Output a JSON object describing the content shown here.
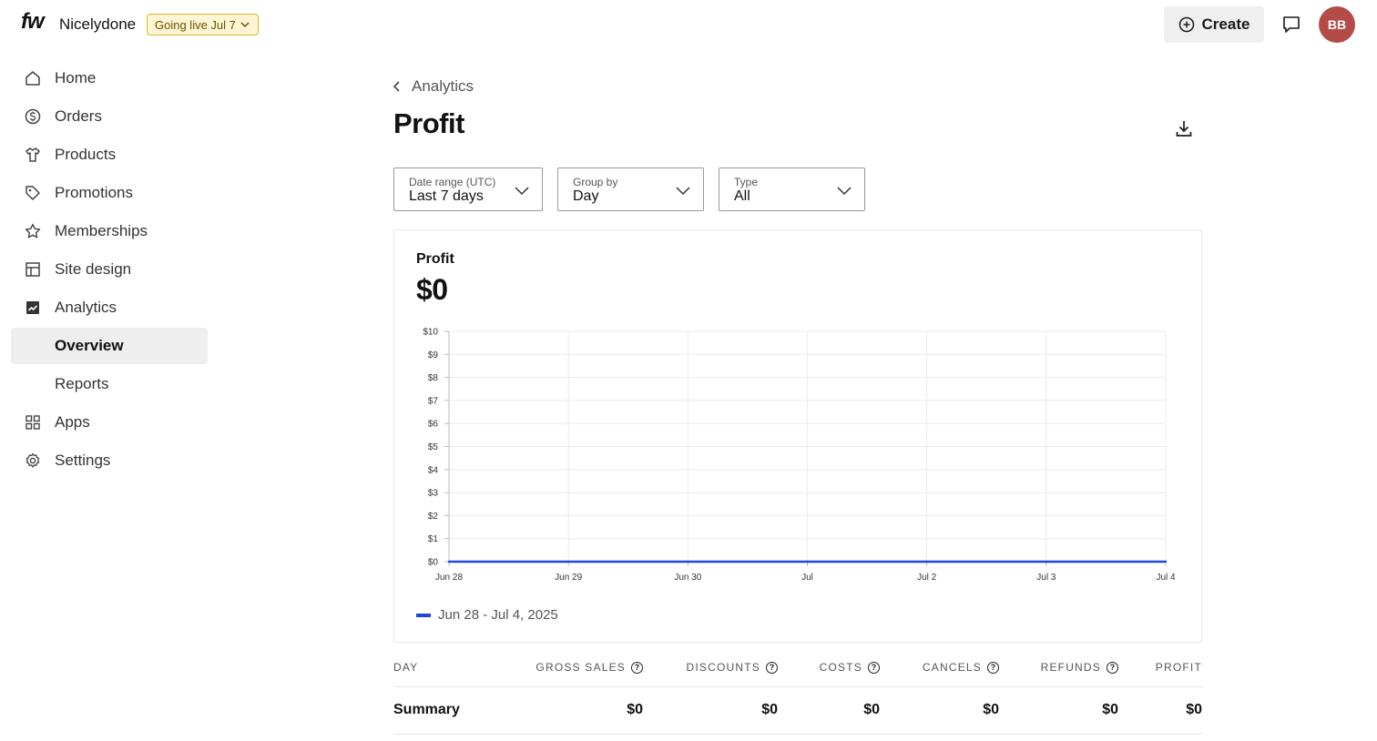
{
  "app": {
    "logo": "fw",
    "store_name": "Nicelydone",
    "go_live_label": "Going live Jul 7",
    "create_label": "Create",
    "avatar_initials": "BB"
  },
  "sidebar": {
    "items": [
      {
        "label": "Home",
        "icon": "home-icon"
      },
      {
        "label": "Orders",
        "icon": "dollar-circle-icon"
      },
      {
        "label": "Products",
        "icon": "shirt-icon"
      },
      {
        "label": "Promotions",
        "icon": "tag-icon"
      },
      {
        "label": "Memberships",
        "icon": "star-icon"
      },
      {
        "label": "Site design",
        "icon": "layout-icon"
      },
      {
        "label": "Analytics",
        "icon": "chart-icon"
      },
      {
        "label": "Overview",
        "active": true
      },
      {
        "label": "Reports"
      },
      {
        "label": "Apps",
        "icon": "grid-icon"
      },
      {
        "label": "Settings",
        "icon": "gear-icon"
      }
    ]
  },
  "main": {
    "breadcrumb": "Analytics",
    "title": "Profit",
    "filters": {
      "date_range": {
        "label": "Date range (UTC)",
        "value": "Last 7 days"
      },
      "group_by": {
        "label": "Group by",
        "value": "Day"
      },
      "type": {
        "label": "Type",
        "value": "All"
      }
    },
    "card": {
      "title": "Profit",
      "value": "$0"
    }
  },
  "chart_data": {
    "type": "line",
    "x": [
      "Jun 28",
      "Jun 29",
      "Jun 30",
      "Jul",
      "Jul 2",
      "Jul 3",
      "Jul 4"
    ],
    "series": [
      {
        "name": "Jun 28 - Jul 4, 2025",
        "values": [
          0,
          0,
          0,
          0,
          0,
          0,
          0
        ],
        "color": "#1f46e0"
      }
    ],
    "y_ticks": [
      "$0",
      "$1",
      "$2",
      "$3",
      "$4",
      "$5",
      "$6",
      "$7",
      "$8",
      "$9",
      "$10"
    ],
    "ylim": [
      0,
      10
    ],
    "grid": true,
    "legend": "bottom-left"
  },
  "table": {
    "columns": [
      "DAY",
      "GROSS SALES",
      "DISCOUNTS",
      "COSTS",
      "CANCELS",
      "REFUNDS",
      "PROFIT"
    ],
    "summary": {
      "label": "Summary",
      "values": [
        "$0",
        "$0",
        "$0",
        "$0",
        "$0",
        "$0"
      ]
    }
  }
}
